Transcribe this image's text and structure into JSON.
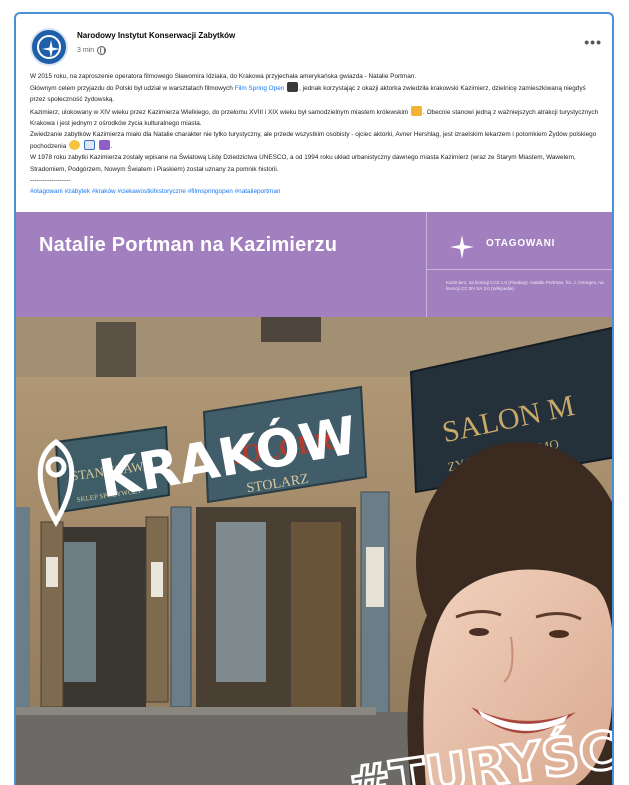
{
  "post": {
    "page_name": "Narodowy Instytut Konserwacji Zabytków",
    "time": "3 min",
    "more_label": "•••",
    "paragraphs": {
      "p1": "W 2015 roku, na zaproszenie operatora filmowego Sławomira Idziaka, do Krakowa przyjechała amerykańska gwiazda - Natalie Portman.",
      "p2a": "Głównym celem przyjazdu do Polski był udział w warsztatach filmowych ",
      "p2link": "Film Spring Open",
      "p2b": ", jednak korzystając z okazji aktorka zwiedziła krakowski Kazimierz, dzielnicę zamieszkiwaną niegdyś przez społeczność żydowską.",
      "p3a": "Kazimierz, ulokowany w XIV wieku przez Kazimierza Wielkiego, do przełomu XVIII i XIX wieku był samodzielnym miastem królewskim",
      "p3b": ". Obecnie stanowi jedną z ważniejszych atrakcji turystycznych Krakowa i jest jednym z ośrodków życia kulturalnego miasta.",
      "p4": "Zwiedzanie zabytków Kazimierza miało dla Natalie charakter nie tylko turystyczny, ale przede wszystkim osobisty - ojciec aktorki, Avner Hershlag, jest izraelskim lekarzem i potomkiem Żydów polskiego pochodzenia",
      "p5": "W 1978 roku zabytki Kazimierza zostały wpisane na Światową Listę Dziedzictwa UNESCO, a od 1994 roku układ urbanistyczny dawnego miasta Kazimierz (wraz ze Starym Miastem, Wawelem, Stradomiem, Podgórzem, Nowym Światem i Piaskiem) został uznany za pomnik historii.",
      "separator": "-------------------",
      "hashtags": "#otagowani #zabytek #kraków #ciekawostkihistoryczne #filmspringopen #natalieportman"
    }
  },
  "media": {
    "banner_title": "Natalie Portman na Kazimierzu",
    "brand_name": "OTAGOWANI",
    "credit": "Kazimierz, na licencji CC0 1.0 (Pixabay). Natalie Portman, fot. J. Georges, na licencji CC BY-SA 3.0 (Wikipedia)",
    "signs": {
      "left_sign": "STANISŁAWA",
      "left_sign_sub": "SKLEP SPOŻYWCZY",
      "center_sign": "HOLCER",
      "center_sign_sub": "STOLARZ",
      "right_sign": "SALON M",
      "right_sign_sub": "ZYGMUNT SZYMO"
    },
    "overlay_text_top": "KRAKÓW",
    "overlay_text_bottom": "#TURYŚCI"
  },
  "colors": {
    "accent_border": "#4a90d9",
    "link": "#1877f2",
    "banner": "#a27fbe",
    "brand_blue": "#1f5ea8"
  },
  "icons": [
    "avatar-logo-icon",
    "globe-icon",
    "more-options-icon",
    "clapper-emoji-icon",
    "crown-emoji-icon",
    "face-emoji-icon",
    "flag-emoji-icon",
    "star-of-david-emoji-icon",
    "location-pin-icon",
    "otagowani-star-icon"
  ]
}
